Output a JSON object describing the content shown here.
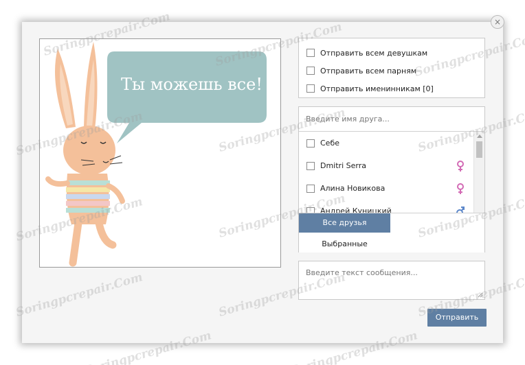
{
  "close_icon": "×",
  "card": {
    "text": "Ты можешь все!",
    "bubble_color": "#8fb8b8",
    "bunny_color": "#f4c09a"
  },
  "send_options": [
    {
      "label": "Отправить всем девушкам",
      "checked": false
    },
    {
      "label": "Отправить всем парням",
      "checked": false
    },
    {
      "label": "Отправить именинникам [0]",
      "checked": false
    }
  ],
  "friends": {
    "search_placeholder": "Введите имя друга...",
    "list": [
      {
        "name": "Себе",
        "gender": ""
      },
      {
        "name": "Dmitri Serra",
        "gender": "female"
      },
      {
        "name": "Алина Новикова",
        "gender": "female"
      },
      {
        "name": "Андрей Куницкий",
        "gender": "male"
      }
    ],
    "tabs": {
      "all": "Все друзья",
      "selected": "Выбранные"
    }
  },
  "message": {
    "placeholder": "Введите текст сообщения..."
  },
  "send_label": "Отправить",
  "watermark": "Soringpcrepair.Com",
  "colors": {
    "accent": "#5f7fa3",
    "female_icon": "#d36bb5",
    "male_icon": "#5b86c9"
  }
}
